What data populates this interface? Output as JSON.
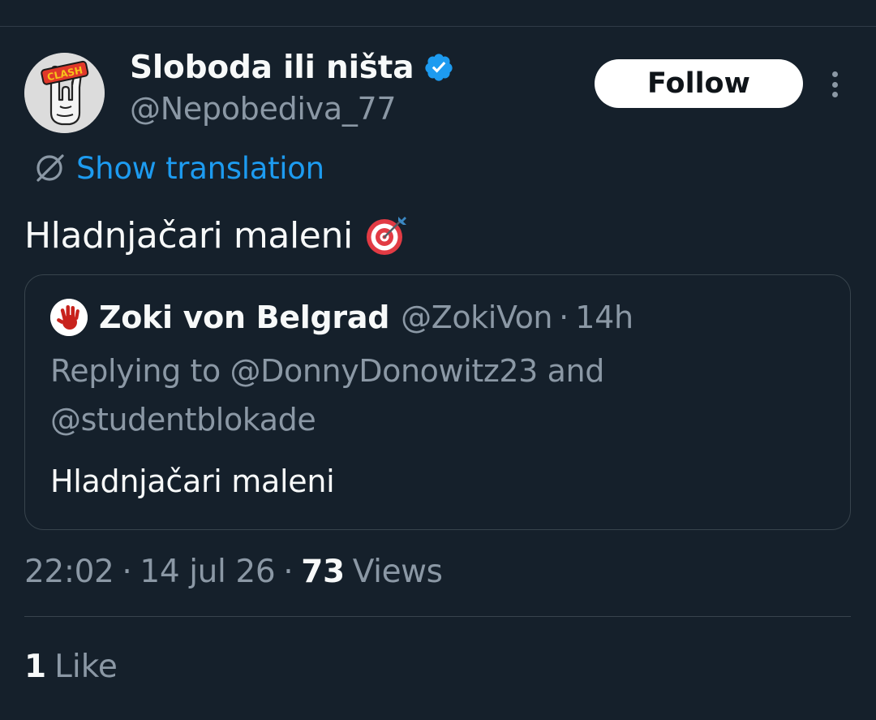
{
  "author": {
    "display_name": "Sloboda ili ništa",
    "handle": "@Nepobediva_77",
    "verified_icon": "verified-badge-icon",
    "avatar_text": "CLASH"
  },
  "actions": {
    "follow_label": "Follow",
    "more_icon": "more-options-icon"
  },
  "translation": {
    "label": "Show translation",
    "icon": "globe-icon"
  },
  "tweet": {
    "text": "Hladnjačari maleni",
    "emoji_icon": "direct-hit-target-icon"
  },
  "quoted": {
    "name": "Zoki von Belgrad",
    "handle": "@ZokiVon",
    "separator": "·",
    "time": "14h",
    "reply_line": "Replying to @DonnyDonowitz23 and @studentblokade",
    "text": "Hladnjačari maleni",
    "avatar_icon": "red-handprint-icon"
  },
  "meta": {
    "time": "22:02",
    "separator": "·",
    "date": "14 jul 26",
    "views_count": "73",
    "views_label": "Views"
  },
  "likes": {
    "count": "1",
    "label": "Like"
  },
  "colors": {
    "background": "#15202b",
    "text_primary": "#f7f9f9",
    "text_secondary": "#8b98a5",
    "accent": "#1d9bf0",
    "border": "#38444d",
    "verified": "#1d9bf0"
  }
}
